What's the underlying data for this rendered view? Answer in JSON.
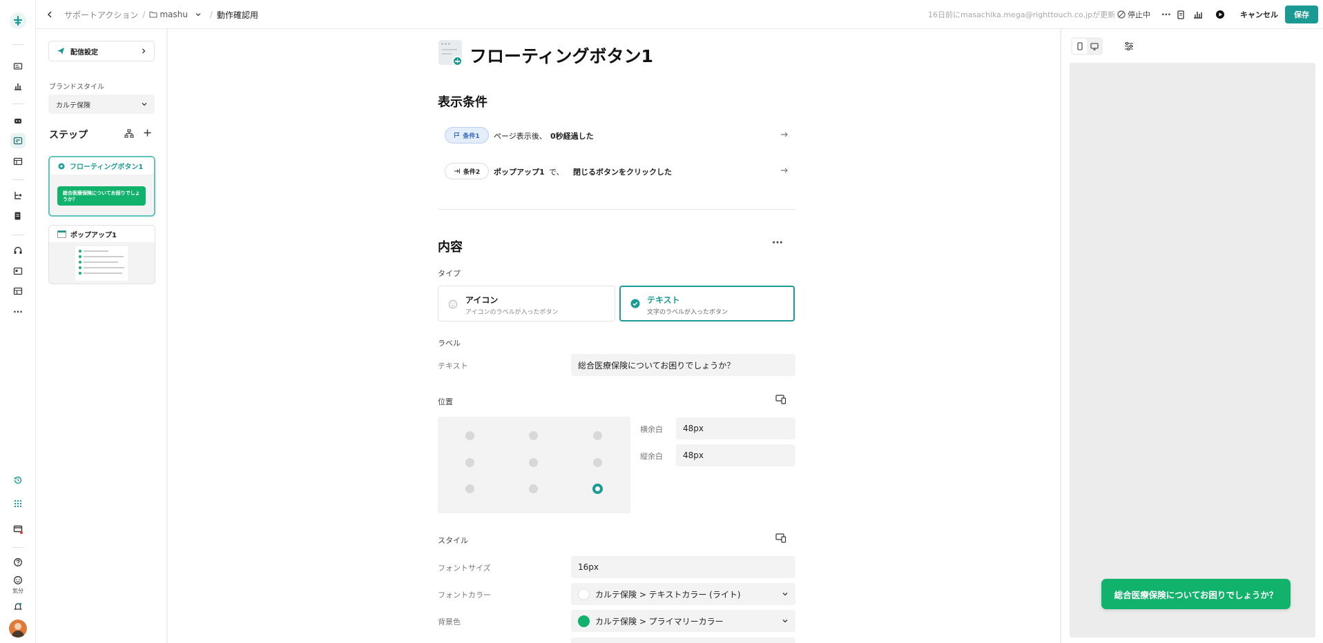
{
  "topbar": {
    "breadcrumb_root": "サポートアクション",
    "folder": "mashu",
    "page": "動作確認用",
    "updated": "16日前にmasachika.mega@righttouch.co.jpが更新",
    "status": "停止中",
    "more": "···",
    "cancel": "キャンセル",
    "save": "保存"
  },
  "rail": {
    "icons": [
      "logo-icon",
      "card-icon",
      "chart-icon",
      "robot-icon",
      "flow-icon",
      "layout-icon",
      "hierarchy-icon",
      "document-icon",
      "headset-icon",
      "template-icon",
      "table-icon",
      "more-icon",
      "history-icon",
      "grid-icon",
      "window-icon",
      "help-icon",
      "mood-icon",
      "bell-icon"
    ],
    "mood_label": "気分",
    "more": "···"
  },
  "steps": {
    "delivery": "配信設定",
    "brand_label": "ブランドスタイル",
    "brand_value": "カルテ保険",
    "title": "ステップ",
    "step1": {
      "name": "フローティングボタン1",
      "preview": "総合医療保険についてお困りでしょうか？"
    },
    "step2": {
      "name": "ポップアップ1"
    }
  },
  "main": {
    "title": "フローティングボタン1",
    "conditions_heading": "表示条件",
    "conditions": [
      {
        "badge": "条件1",
        "text_a": "ページ表示後、",
        "text_b": "0秒経過した"
      },
      {
        "badge": "条件2",
        "text_a": "ポップアップ1",
        "text_b": "で、",
        "text_c": "閉じるボタンをクリックした"
      }
    ],
    "content_heading": "内容",
    "more": "···",
    "type_label": "タイプ",
    "types": [
      {
        "title": "アイコン",
        "desc": "アイコンのラベルが入ったボタン"
      },
      {
        "title": "テキスト",
        "desc": "文字のラベルが入ったボタン"
      }
    ],
    "label_heading": "ラベル",
    "text_label": "テキスト",
    "text_value": "総合医療保険についてお困りでしょうか？",
    "position_heading": "位置",
    "h_margin_label": "横余白",
    "h_margin_value": "48px",
    "v_margin_label": "縦余白",
    "v_margin_value": "48px",
    "style_heading": "スタイル",
    "font_size_label": "フォントサイズ",
    "font_size_value": "16px",
    "font_color_label": "フォントカラー",
    "font_color_value": "カルテ保険 > テキストカラー (ライト)",
    "bg_label": "背景色",
    "bg_value": "カルテ保険 > プライマリーカラー"
  },
  "preview": {
    "button_text": "総合医療保険についてお困りでしょうか？"
  },
  "colors": {
    "accent": "#1a9a93",
    "primary_green": "#10b26c"
  }
}
